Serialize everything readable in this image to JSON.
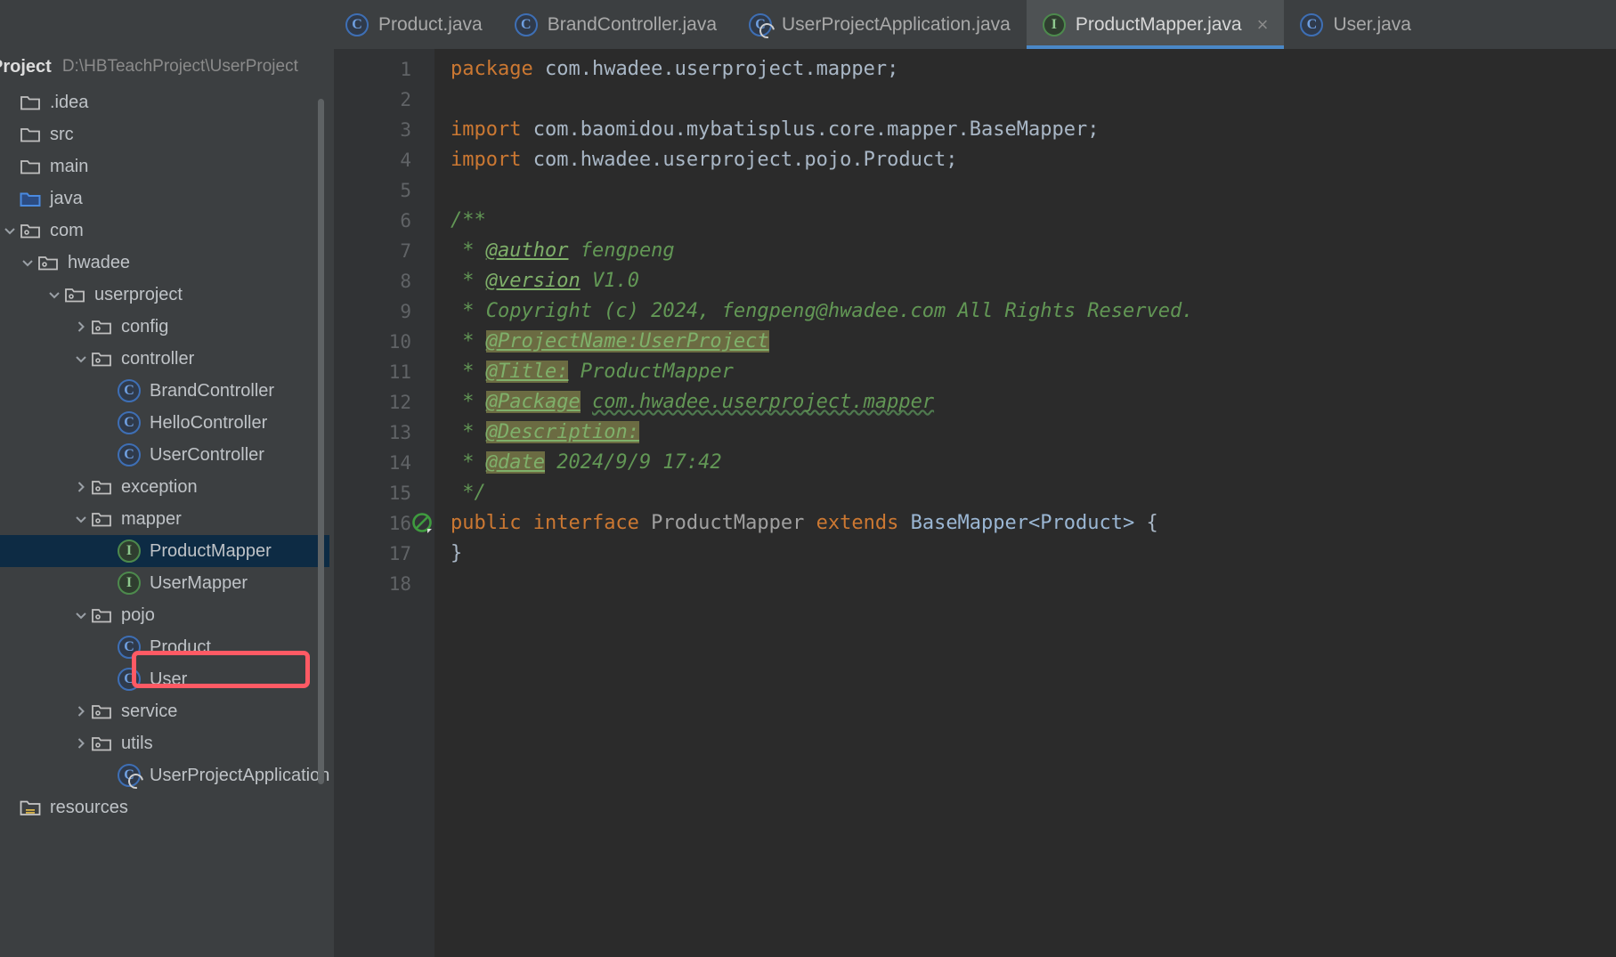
{
  "window": {
    "theme_bg": "#3c3f41",
    "editor_bg": "#2b2b2b",
    "accent": "#4a88c7",
    "annotation_color": "#ff5a64"
  },
  "tabs": [
    {
      "label": "Product.java",
      "icon": "java-class-icon",
      "icon_kind": "cls",
      "active": false,
      "closable": false
    },
    {
      "label": "BrandController.java",
      "icon": "java-class-icon",
      "icon_kind": "cls",
      "active": false,
      "closable": false
    },
    {
      "label": "UserProjectApplication.java",
      "icon": "spring-boot-class-icon",
      "icon_kind": "spring",
      "active": false,
      "closable": false
    },
    {
      "label": "ProductMapper.java",
      "icon": "java-interface-icon",
      "icon_kind": "iface",
      "active": true,
      "closable": true,
      "close_label": "×"
    },
    {
      "label": "User.java",
      "icon": "java-class-icon",
      "icon_kind": "cls",
      "active": false,
      "closable": false
    }
  ],
  "sidebar": {
    "title": "Project",
    "path": "D:\\HBTeachProject\\UserProject",
    "tree": [
      {
        "label": ".idea",
        "indent": 0,
        "arrow": "none",
        "icon": "folder-icon",
        "selected": false
      },
      {
        "label": "src",
        "indent": 0,
        "arrow": "none",
        "icon": "folder-icon",
        "selected": false
      },
      {
        "label": "main",
        "indent": 0,
        "arrow": "none",
        "icon": "folder-icon",
        "selected": false
      },
      {
        "label": "java",
        "indent": 1,
        "arrow": "none",
        "icon": "source-root-folder-icon",
        "selected": false
      },
      {
        "label": "com",
        "indent": 1,
        "arrow": "expanded",
        "icon": "package-folder-icon",
        "selected": false
      },
      {
        "label": "hwadee",
        "indent": 2,
        "arrow": "expanded",
        "icon": "package-folder-icon",
        "selected": false
      },
      {
        "label": "userproject",
        "indent": 3,
        "arrow": "expanded",
        "icon": "package-folder-icon",
        "selected": false
      },
      {
        "label": "config",
        "indent": 4,
        "arrow": "collapsed",
        "icon": "package-folder-icon",
        "selected": false
      },
      {
        "label": "controller",
        "indent": 4,
        "arrow": "expanded",
        "icon": "package-folder-icon",
        "selected": false
      },
      {
        "label": "BrandController",
        "indent": 5,
        "arrow": "none",
        "icon": "java-class-icon",
        "selected": false
      },
      {
        "label": "HelloController",
        "indent": 5,
        "arrow": "none",
        "icon": "java-class-icon",
        "selected": false
      },
      {
        "label": "UserController",
        "indent": 5,
        "arrow": "none",
        "icon": "java-class-icon",
        "selected": false
      },
      {
        "label": "exception",
        "indent": 4,
        "arrow": "collapsed",
        "icon": "package-folder-icon",
        "selected": false
      },
      {
        "label": "mapper",
        "indent": 4,
        "arrow": "expanded",
        "icon": "package-folder-icon",
        "selected": false
      },
      {
        "label": "ProductMapper",
        "indent": 5,
        "arrow": "none",
        "icon": "java-interface-icon",
        "selected": true
      },
      {
        "label": "UserMapper",
        "indent": 5,
        "arrow": "none",
        "icon": "java-interface-icon",
        "selected": false
      },
      {
        "label": "pojo",
        "indent": 4,
        "arrow": "expanded",
        "icon": "package-folder-icon",
        "selected": false
      },
      {
        "label": "Product",
        "indent": 5,
        "arrow": "none",
        "icon": "java-class-icon",
        "selected": false
      },
      {
        "label": "User",
        "indent": 5,
        "arrow": "none",
        "icon": "java-class-icon",
        "selected": false
      },
      {
        "label": "service",
        "indent": 4,
        "arrow": "collapsed",
        "icon": "package-folder-icon",
        "selected": false
      },
      {
        "label": "utils",
        "indent": 4,
        "arrow": "collapsed",
        "icon": "package-folder-icon",
        "selected": false
      },
      {
        "label": "UserProjectApplication",
        "indent": 5,
        "arrow": "none",
        "icon": "spring-boot-class-icon",
        "selected": false
      },
      {
        "label": "resources",
        "indent": 0,
        "arrow": "none",
        "icon": "resource-root-folder-icon",
        "selected": false
      }
    ]
  },
  "editor": {
    "file": "ProductMapper.java",
    "gutter_icon_line": 16,
    "gutter_icon_name": "mybatis-mapper-icon",
    "line_numbers": [
      1,
      2,
      3,
      4,
      5,
      6,
      7,
      8,
      9,
      10,
      11,
      12,
      13,
      14,
      15,
      16,
      17,
      18
    ],
    "lines": [
      {
        "n": 1,
        "segments": [
          {
            "t": "package ",
            "c": "kw"
          },
          {
            "t": "com.hwadee.userproject.mapper;",
            "c": "typ"
          }
        ]
      },
      {
        "n": 2,
        "segments": []
      },
      {
        "n": 3,
        "segments": [
          {
            "t": "import ",
            "c": "kw"
          },
          {
            "t": "com.baomidou.mybatisplus.core.mapper.BaseMapper;",
            "c": "typ"
          }
        ]
      },
      {
        "n": 4,
        "segments": [
          {
            "t": "import ",
            "c": "kw"
          },
          {
            "t": "com.hwadee.userproject.pojo.Product;",
            "c": "typ"
          }
        ]
      },
      {
        "n": 5,
        "segments": []
      },
      {
        "n": 6,
        "segments": [
          {
            "t": "/**",
            "c": "cmt"
          }
        ]
      },
      {
        "n": 7,
        "segments": [
          {
            "t": " * ",
            "c": "cmt"
          },
          {
            "t": "@author",
            "c": "cmt-tag"
          },
          {
            "t": " fengpeng",
            "c": "cmt"
          }
        ]
      },
      {
        "n": 8,
        "segments": [
          {
            "t": " * ",
            "c": "cmt"
          },
          {
            "t": "@version",
            "c": "cmt-tag"
          },
          {
            "t": " V1.0",
            "c": "cmt"
          }
        ]
      },
      {
        "n": 9,
        "segments": [
          {
            "t": " * Copyright (c) 2024, fengpeng@hwadee.com All Rights Reserved.",
            "c": "cmt"
          }
        ]
      },
      {
        "n": 10,
        "segments": [
          {
            "t": " * ",
            "c": "cmt"
          },
          {
            "t": "@ProjectName:UserProject",
            "c": "cmt-tag",
            "hl": true
          }
        ]
      },
      {
        "n": 11,
        "segments": [
          {
            "t": " * ",
            "c": "cmt"
          },
          {
            "t": "@Title:",
            "c": "cmt-tag",
            "hl": true
          },
          {
            "t": " ProductMapper",
            "c": "cmt"
          }
        ]
      },
      {
        "n": 12,
        "segments": [
          {
            "t": " * ",
            "c": "cmt"
          },
          {
            "t": "@Package",
            "c": "cmt-tag",
            "hl": true
          },
          {
            "t": " ",
            "c": "cmt"
          },
          {
            "t": "com.hwadee.userproject.mapper",
            "c": "cmt",
            "squig": true
          }
        ]
      },
      {
        "n": 13,
        "segments": [
          {
            "t": " * ",
            "c": "cmt"
          },
          {
            "t": "@Description:",
            "c": "cmt-tag",
            "hl": true
          }
        ]
      },
      {
        "n": 14,
        "segments": [
          {
            "t": " * ",
            "c": "cmt"
          },
          {
            "t": "@date",
            "c": "cmt-tag",
            "hl": true
          },
          {
            "t": " 2024/9/9 17:42",
            "c": "cmt"
          }
        ]
      },
      {
        "n": 15,
        "segments": [
          {
            "t": " */",
            "c": "cmt"
          }
        ]
      },
      {
        "n": 16,
        "segments": [
          {
            "t": "public ",
            "c": "kw"
          },
          {
            "t": "interface ",
            "c": "kw"
          },
          {
            "t": "ProductMapper",
            "c": "iname"
          },
          {
            "t": " ",
            "c": "typ"
          },
          {
            "t": "extends ",
            "c": "kw"
          },
          {
            "t": "BaseMapper<Product>",
            "c": "cls-ref"
          },
          {
            "t": " {",
            "c": "typ"
          }
        ]
      },
      {
        "n": 17,
        "segments": [
          {
            "t": "}",
            "c": "typ"
          }
        ]
      },
      {
        "n": 18,
        "segments": []
      }
    ]
  }
}
